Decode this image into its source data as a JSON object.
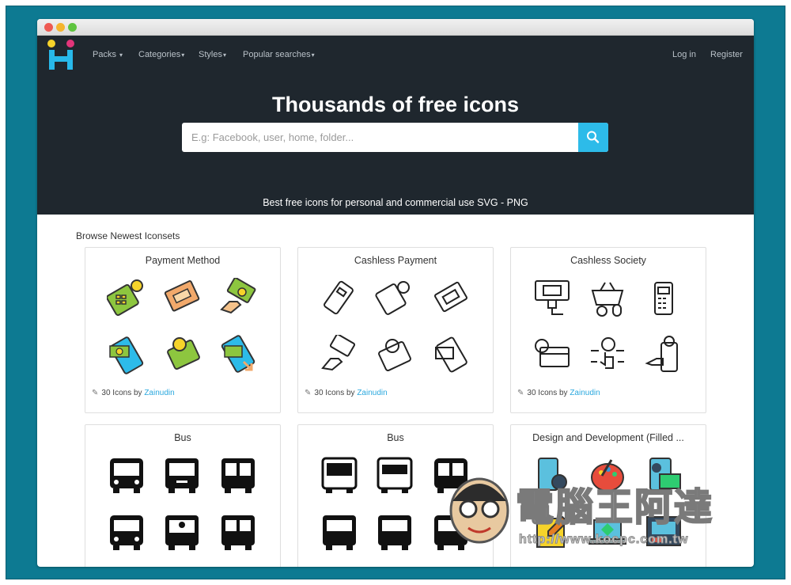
{
  "nav": {
    "packs": "Packs",
    "categories": "Categories",
    "styles": "Styles",
    "popular": "Popular searches",
    "login": "Log in",
    "register": "Register",
    "caret": "▾"
  },
  "hero": {
    "title": "Thousands of free icons",
    "search_placeholder": "E.g: Facebook, user, home, folder...",
    "subtitle": "Best free icons for personal and commercial use SVG - PNG"
  },
  "section_title": "Browse Newest Iconsets",
  "cards": [
    {
      "title": "Payment Method",
      "count": "30 Icons by",
      "author": "Zainudin",
      "style": "filled-color"
    },
    {
      "title": "Cashless Payment",
      "count": "30 Icons by",
      "author": "Zainudin",
      "style": "outline"
    },
    {
      "title": "Cashless Society",
      "count": "30 Icons by",
      "author": "Zainudin",
      "style": "outline"
    },
    {
      "title": "Bus",
      "style": "glyph"
    },
    {
      "title": "Bus",
      "style": "glyph"
    },
    {
      "title": "Design and Development (Filled ...",
      "style": "filled-color"
    }
  ],
  "watermark": {
    "text": "電腦王阿達",
    "url": "http://www.kocpc.com.tw"
  },
  "colors": {
    "hero_bg": "#1f272e",
    "accent": "#2dbbe9",
    "frame": "#0d7a92",
    "link": "#2aa8de"
  }
}
